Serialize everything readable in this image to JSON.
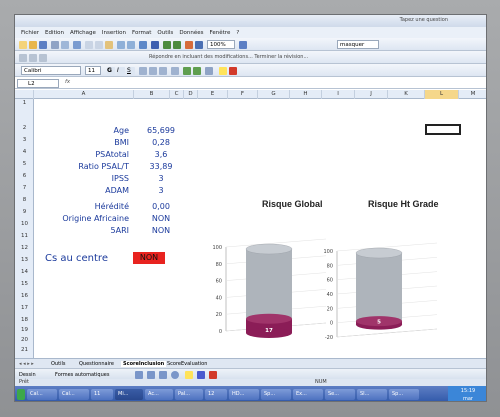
{
  "app": {
    "help_placeholder": "Tapez une question",
    "menu": [
      "Fichier",
      "Edition",
      "Affichage",
      "Insertion",
      "Format",
      "Outils",
      "Données",
      "Fenêtre",
      "?"
    ],
    "zoom": "100%",
    "style_box": "masquer",
    "font_name": "Calibri",
    "font_size": "11",
    "review_text": "Répondre en incluant des modifications...  Terminer la révision..."
  },
  "formula_bar": {
    "cell_ref": "L2",
    "fx": "fx"
  },
  "columns": [
    "A",
    "B",
    "C",
    "D",
    "E",
    "F",
    "G",
    "H",
    "I",
    "J",
    "K",
    "L",
    "M"
  ],
  "rows": [
    "1",
    "2",
    "3",
    "4",
    "5",
    "6",
    "7",
    "8",
    "9",
    "10",
    "11",
    "12",
    "13",
    "14",
    "15",
    "16",
    "17",
    "18",
    "19",
    "20",
    "21"
  ],
  "params": [
    {
      "label": "Age",
      "value": "65,699"
    },
    {
      "label": "BMI",
      "value": "0,28"
    },
    {
      "label": "PSAtotal",
      "value": "3,6"
    },
    {
      "label": "Ratio PSAL/T",
      "value": "33,89"
    },
    {
      "label": "IPSS",
      "value": "3"
    },
    {
      "label": "ADAM",
      "value": "3"
    },
    {
      "label": "Hérédité",
      "value": "0,00"
    },
    {
      "label": "Origine Africaine",
      "value": "NON"
    },
    {
      "label": "5ARI",
      "value": "NON"
    }
  ],
  "result": {
    "label": "Cs au centre",
    "value": "NON"
  },
  "charts": [
    {
      "title": "Risque Global",
      "value": 17,
      "value_label": "17",
      "ticks": [
        "100",
        "80",
        "60",
        "40",
        "20",
        "0"
      ]
    },
    {
      "title": "Risque Ht Grade",
      "value": 5,
      "value_label": "5",
      "ticks": [
        "100",
        "80",
        "60",
        "40",
        "20",
        "0",
        "-20"
      ]
    }
  ],
  "sheet_tabs": [
    "Outils",
    "Questionnaire",
    "ScoreInclusion",
    "ScoreEvaluation"
  ],
  "draw_bar": {
    "dessin": "Dessin",
    "formes": "Formes automatiques"
  },
  "status": {
    "left": "Prêt",
    "right": "NUM"
  },
  "taskbar": {
    "items": [
      "Cal...",
      "Cal...",
      "11",
      "Mi...",
      "Ac...",
      "Pal...",
      "12",
      "HD...",
      "Sp...",
      "Ex...",
      "Se...",
      "SI...",
      "Sp..."
    ],
    "time": "15:19",
    "day": "mar"
  },
  "colors": {
    "accent_text": "#1b3a9c",
    "badge_red": "#e8231f",
    "cylinder": "#aeb4bb",
    "cylinder_base": "#8b1d57"
  }
}
